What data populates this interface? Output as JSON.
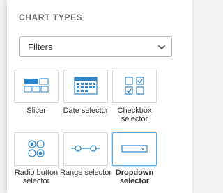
{
  "panel": {
    "heading": "CHART TYPES",
    "filter_dropdown": {
      "value": "Filters"
    }
  },
  "chart_types": [
    {
      "label": "Slicer",
      "icon": "slicer-icon",
      "selected": false
    },
    {
      "label": "Date selector",
      "icon": "calendar-icon",
      "selected": false
    },
    {
      "label": "Checkbox selector",
      "icon": "checkbox-icon",
      "selected": false
    },
    {
      "label": "Radio button selector",
      "icon": "radio-button-icon",
      "selected": false
    },
    {
      "label": "Range selector",
      "icon": "range-slider-icon",
      "selected": false
    },
    {
      "label": "Dropdown selector",
      "icon": "dropdown-icon",
      "selected": true
    }
  ],
  "colors": {
    "accent": "#5aa9e6",
    "icon_blue": "#2f86c8",
    "heading": "#6b6b6b"
  }
}
